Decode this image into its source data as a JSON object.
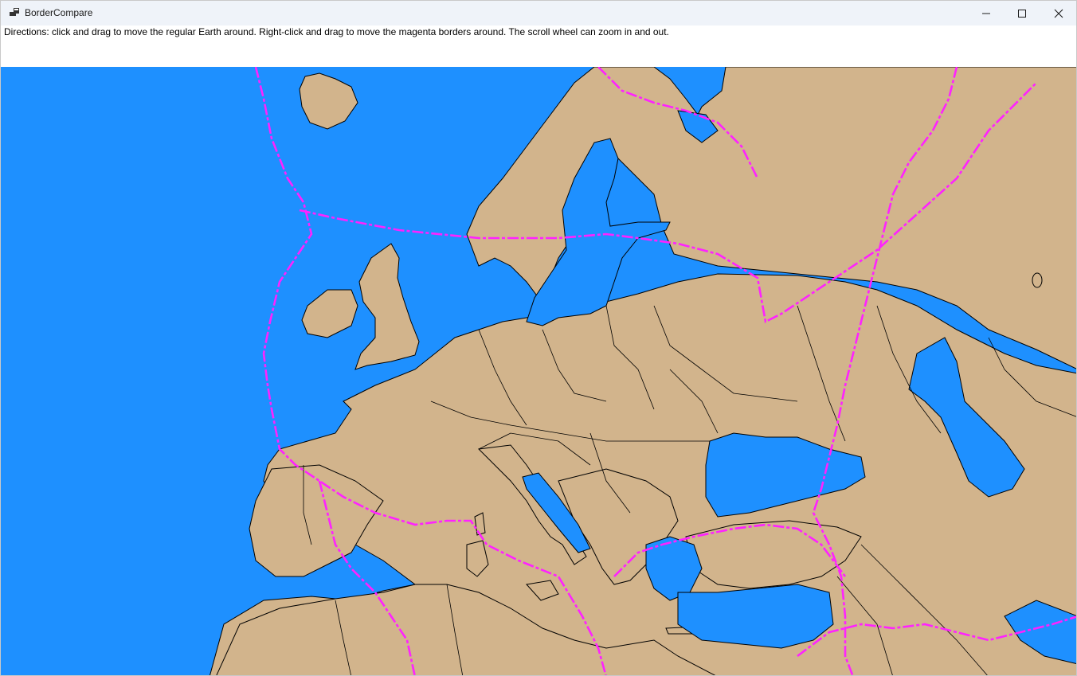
{
  "window": {
    "title": "BorderCompare",
    "icon": "app-window-icon",
    "controls": {
      "minimize_icon": "minimize-icon",
      "maximize_icon": "maximize-icon",
      "close_icon": "close-icon"
    }
  },
  "directions": {
    "text": "Directions: click and drag to move the regular Earth around. Right-click and drag to move the magenta borders around. The scroll wheel can zoom in and out."
  },
  "map": {
    "view": "Europe",
    "colors": {
      "ocean": "#1e90ff",
      "land": "#d2b48c",
      "border": "#000000",
      "compare_borders": "#ff22ff"
    }
  }
}
